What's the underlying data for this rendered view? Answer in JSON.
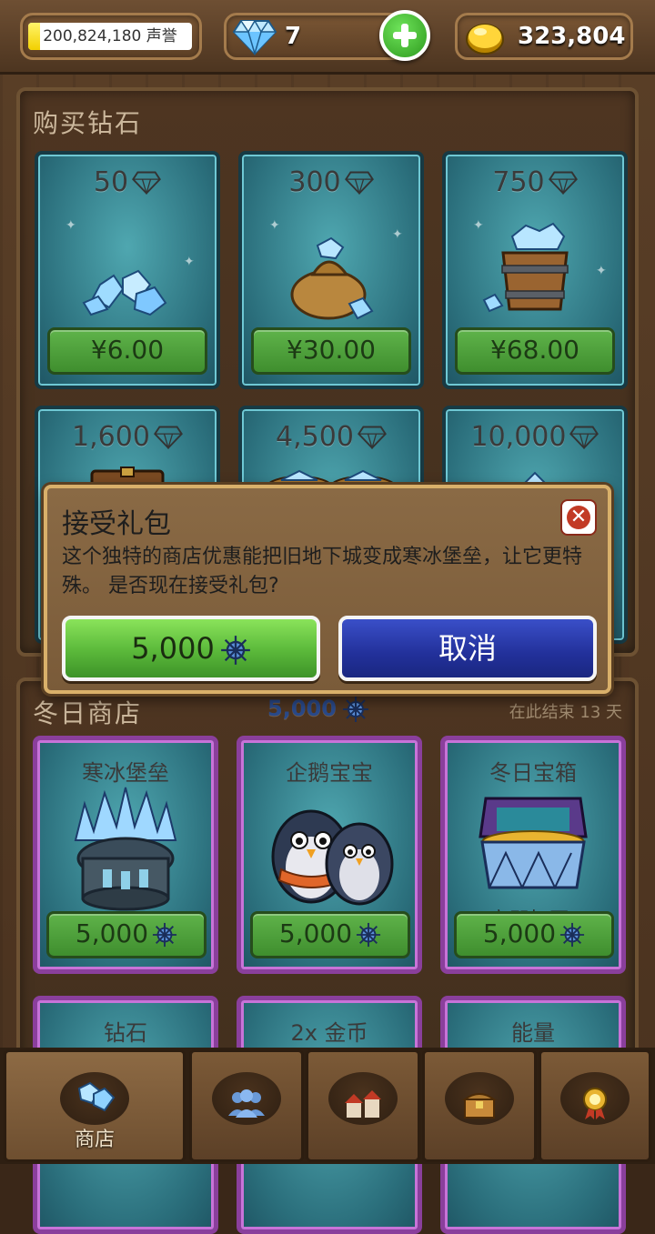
{
  "topbar": {
    "prestige": {
      "value_text": "200,824,180 声誉",
      "fill_fraction": 0.07
    },
    "gems": {
      "value": "7",
      "icon": "diamond-icon",
      "add_icon": "plus-icon"
    },
    "gold": {
      "value": "323,804",
      "icon": "gold-coin-icon"
    }
  },
  "buy_gems": {
    "title": "购买钻石",
    "items": [
      {
        "amount": "50",
        "price": "¥6.00",
        "art": "gem-pile"
      },
      {
        "amount": "300",
        "price": "¥30.00",
        "art": "gem-sack"
      },
      {
        "amount": "750",
        "price": "¥68.00",
        "art": "gem-bucket"
      },
      {
        "amount": "1,600",
        "art": "gem-chest"
      },
      {
        "amount": "4,500",
        "art": "gem-heap"
      },
      {
        "amount": "10,000",
        "art": "gem-mountain"
      }
    ]
  },
  "modal": {
    "title": "接受礼包",
    "body": "这个独特的商店优惠能把旧地下城变成寒冰堡垒，让它更特殊。 是否现在接受礼包?",
    "accept_label": "5,000",
    "cancel_label": "取消",
    "close_icon": "close-icon"
  },
  "winter_shop": {
    "title": "冬日商店",
    "cost": "5,000",
    "days_left": "在此结束 13 天",
    "items": [
      {
        "name": "寒冰堡垒",
        "price": "5,000",
        "art": "ice-fortress"
      },
      {
        "name": "企鹅宝宝",
        "price": "5,000",
        "art": "penguins"
      },
      {
        "name": "冬日宝箱",
        "price": "5,000",
        "art": "winter-chest",
        "note": "立即打开!"
      },
      {
        "name": "钻石"
      },
      {
        "name": "2x 金币"
      },
      {
        "name": "能量"
      }
    ]
  },
  "bottom_nav": {
    "tabs": [
      {
        "label": "商店",
        "icon": "shop-gems-icon",
        "active": true
      },
      {
        "label": "",
        "icon": "people-icon"
      },
      {
        "label": "",
        "icon": "buildings-icon"
      },
      {
        "label": "",
        "icon": "treasure-chest-icon"
      },
      {
        "label": "",
        "icon": "medal-icon"
      }
    ]
  }
}
